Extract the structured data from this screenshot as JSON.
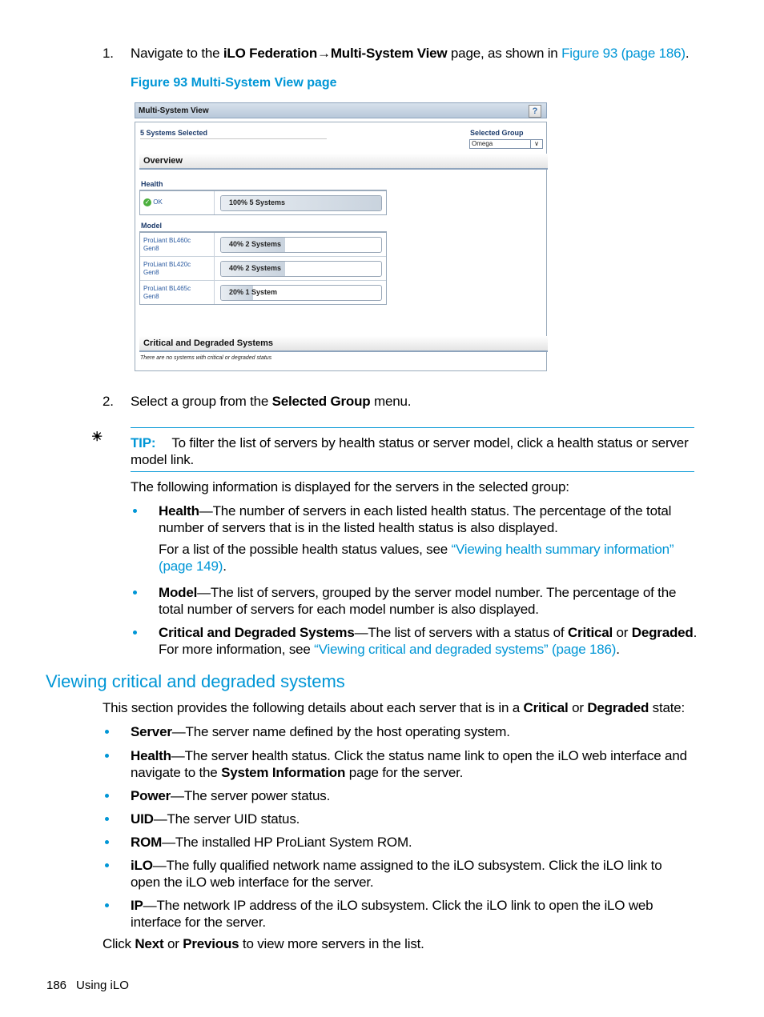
{
  "steps": {
    "step1": {
      "number": "1.",
      "text_a": "Navigate to the ",
      "bold_a": "iLO Federation",
      "arrow": "→",
      "bold_b": "Multi-System View",
      "text_b": " page, as shown in ",
      "link": "Figure 93 (page 186)",
      "text_c": "."
    },
    "step2": {
      "number": "2.",
      "text_a": "Select a group from the ",
      "bold": "Selected Group",
      "text_b": " menu."
    }
  },
  "figure": {
    "caption": "Figure 93 Multi-System View page",
    "window_title": "Multi-System View",
    "help_icon": "?",
    "systems_selected": "5 Systems Selected",
    "selected_group_label": "Selected Group",
    "selected_group_value": "Omega",
    "overview_heading": "Overview",
    "health_heading": "Health",
    "health_rows": [
      {
        "status": "OK",
        "bar_label": "100% 5 Systems",
        "percent": 100
      }
    ],
    "model_heading": "Model",
    "model_rows": [
      {
        "model_line1": "ProLiant BL460c",
        "model_line2": "Gen8",
        "bar_label": "40% 2 Systems",
        "percent": 40
      },
      {
        "model_line1": "ProLiant BL420c",
        "model_line2": "Gen8",
        "bar_label": "40% 2 Systems",
        "percent": 40
      },
      {
        "model_line1": "ProLiant BL465c",
        "model_line2": "Gen8",
        "bar_label": "20% 1 System",
        "percent": 20
      }
    ],
    "critical_heading": "Critical and Degraded Systems",
    "critical_note": "There are no systems with critical or degraded status"
  },
  "tip": {
    "icon": "lightbulb-icon",
    "label": "TIP:",
    "text": "To filter the list of servers by health status or server model, click a health status or server model link."
  },
  "info_intro": "The following information is displayed for the servers in the selected group:",
  "info_items": [
    {
      "bold": "Health",
      "text": "—The number of servers in each listed health status. The percentage of the total number of servers that is in the listed health status is also displayed.",
      "sub_text": "For a list of the possible health status values, see ",
      "sub_link": "“Viewing health summary information” (page 149)",
      "sub_end": "."
    },
    {
      "bold": "Model",
      "text": "—The list of servers, grouped by the server model number. The percentage of the total number of servers for each model number is also displayed."
    },
    {
      "bold": "Critical and Degraded Systems",
      "text": "—The list of servers with a status of ",
      "bold2": "Critical",
      "mid": " or ",
      "bold3": "Degraded",
      "end": ".",
      "line2": "For more information, see ",
      "link": "“Viewing critical and degraded systems” (page 186)",
      "link_end": "."
    }
  ],
  "section": {
    "heading": "Viewing critical and degraded systems",
    "intro_a": "This section provides the following details about each server that is in a ",
    "intro_b1": "Critical",
    "intro_mid": " or ",
    "intro_b2": "Degraded",
    "intro_end": " state:",
    "items": [
      {
        "bold": "Server",
        "text": "—The server name defined by the host operating system."
      },
      {
        "bold": "Health",
        "text": "—The server health status. Click the status name link to open the iLO web interface and",
        "line2a": "navigate to the ",
        "line2b": "System Information",
        "line2c": " page for the server."
      },
      {
        "bold": "Power",
        "text": "—The server power status."
      },
      {
        "bold": "UID",
        "text": "—The server UID status."
      },
      {
        "bold": "ROM",
        "text": "—The installed HP ProLiant System ROM."
      },
      {
        "bold": "iLO",
        "text": "—The fully qualified network name assigned to the iLO subsystem. Click the iLO link to",
        "line2": "open the iLO web interface for the server."
      },
      {
        "bold": "IP",
        "text": "—The network IP address of the iLO subsystem. Click the iLO link to open the iLO web",
        "line2": "interface for the server."
      }
    ],
    "closing_a": "Click ",
    "closing_b1": "Next",
    "closing_mid": " or ",
    "closing_b2": "Previous",
    "closing_end": " to view more servers in the list."
  },
  "footer": {
    "page_number": "186",
    "chapter": "Using iLO"
  }
}
